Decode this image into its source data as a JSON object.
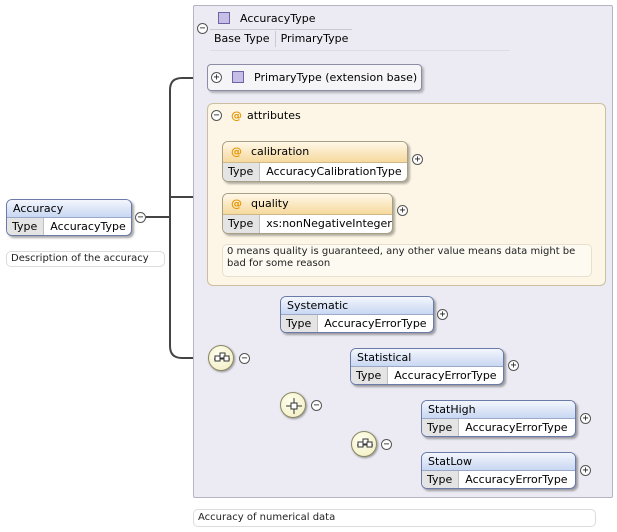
{
  "root": {
    "name": "Accuracy",
    "type_key": "Type",
    "type_value": "AccuracyType",
    "doc": "Description of the accuracy"
  },
  "complex_type": {
    "name": "AccuracyType",
    "base_type_label": "Base Type",
    "base_type_value": "PrimaryType",
    "extension_label": "PrimaryType (extension base)",
    "doc": "Accuracy of numerical data"
  },
  "attributes": {
    "label": "attributes",
    "items": [
      {
        "name": "calibration",
        "type_key": "Type",
        "type_value": "AccuracyCalibrationType"
      },
      {
        "name": "quality",
        "type_key": "Type",
        "type_value": "xs:nonNegativeInteger",
        "doc": "0 means quality is guaranteed, any other value means data might be bad for some reason"
      }
    ]
  },
  "elements": {
    "systematic": {
      "name": "Systematic",
      "type_key": "Type",
      "type_value": "AccuracyErrorType"
    },
    "statistical": {
      "name": "Statistical",
      "type_key": "Type",
      "type_value": "AccuracyErrorType"
    },
    "stat_high": {
      "name": "StatHigh",
      "type_key": "Type",
      "type_value": "AccuracyErrorType"
    },
    "stat_low": {
      "name": "StatLow",
      "type_key": "Type",
      "type_value": "AccuracyErrorType"
    }
  },
  "symbols": {
    "expand": "+",
    "collapse": "−",
    "attribute": "@"
  },
  "colors": {
    "element_header": "#c8d7f2",
    "attribute_header": "#f6d99d",
    "type_panel": "#ecebf3",
    "attributes_panel": "#fdf6e6"
  }
}
